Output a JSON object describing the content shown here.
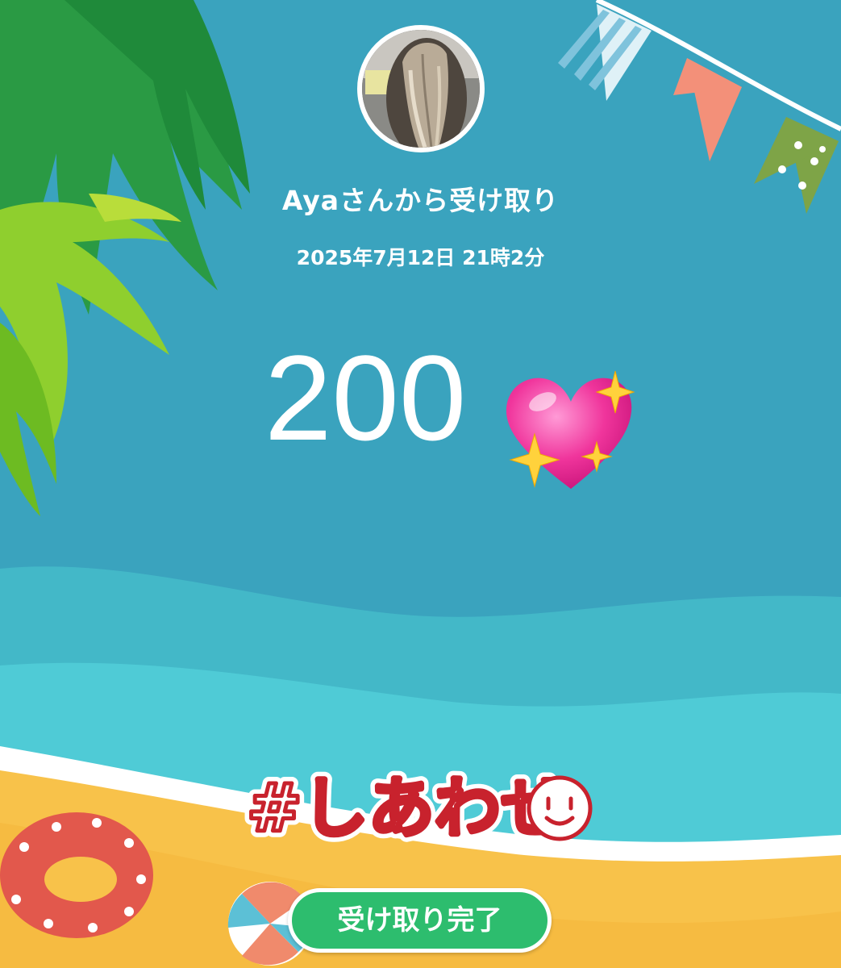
{
  "receipt": {
    "sender_text": "Ayaさんから受け取り",
    "date": "2025年7月12日 21時2分",
    "amount": "200",
    "hashtag": "#しあわせ",
    "complete_button": "受け取り完了"
  },
  "icons": {
    "amount_emoji": "sparkling-heart-icon",
    "avatar": "avatar-photo"
  },
  "colors": {
    "sky": "#3aa3be",
    "sea_light": "#4fcbd6",
    "sand": "#f8c24a",
    "button": "#2dbd6e",
    "hashtag_red": "#c8222d"
  }
}
